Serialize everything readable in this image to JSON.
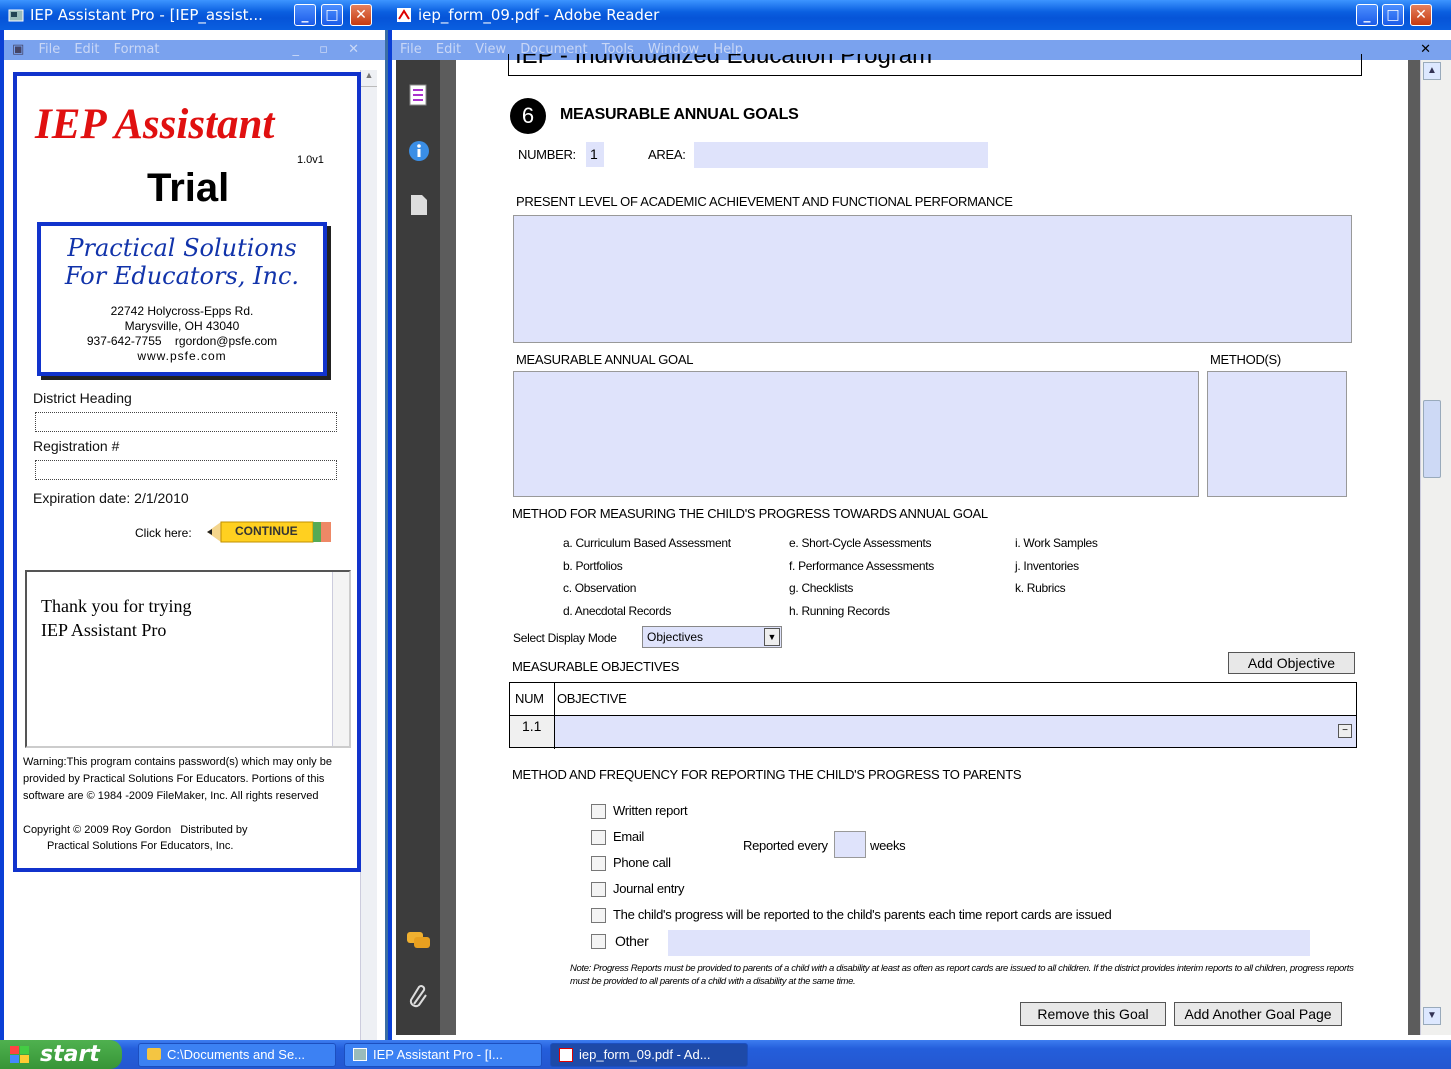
{
  "left_window": {
    "title": "IEP Assistant Pro - [IEP_assist...",
    "menu": [
      "File",
      "Edit",
      "Format"
    ],
    "brand": {
      "name": "IEP Assistant",
      "version": "1.0v1",
      "edition": "Trial"
    },
    "company": {
      "name_line1": "Practical Solutions",
      "name_line2": "For Educators, Inc.",
      "address1": "22742 Holycross-Epps Rd.",
      "address2": "Marysville, OH 43040",
      "phone_email": "937-642-7755    rgordon@psfe.com",
      "web": "www.psfe.com"
    },
    "district_heading_label": "District Heading",
    "registration_label": "Registration #",
    "expiration": "Expiration date: 2/1/2010",
    "click_here": "Click here:",
    "continue_label": "CONTINUE",
    "message_line1": "Thank you for trying",
    "message_line2": "IEP Assistant Pro",
    "warning": "Warning:This program contains password(s) which may only be provided by Practical Solutions For Educators.  Portions of this software are © 1984 -2009 FileMaker, Inc. All rights reserved",
    "copyright_line1": "Copyright © 2009 Roy Gordon   Distributed by",
    "copyright_line2": "Practical Solutions For Educators, Inc."
  },
  "right_window": {
    "title": "iep_form_09.pdf - Adobe Reader",
    "menu": [
      "File",
      "Edit",
      "View",
      "Document",
      "Tools",
      "Window",
      "Help"
    ],
    "header_partial": "IEP - Individualized Education Program",
    "section_number": "6",
    "section_title": "MEASURABLE ANNUAL GOALS",
    "number_label": "NUMBER:",
    "number_value": "1",
    "area_label": "AREA:",
    "present_level_label": "PRESENT LEVEL OF ACADEMIC ACHIEVEMENT AND FUNCTIONAL PERFORMANCE",
    "goal_label": "MEASURABLE ANNUAL GOAL",
    "methods_label": "METHOD(S)",
    "measuring_label": "METHOD FOR MEASURING THE CHILD'S PROGRESS TOWARDS ANNUAL GOAL",
    "methods_col1": [
      "a. Curriculum Based Assessment",
      "b. Portfolios",
      "c. Observation",
      "d. Anecdotal Records"
    ],
    "methods_col2": [
      "e. Short-Cycle Assessments",
      "f. Performance Assessments",
      "g. Checklists",
      "h. Running Records"
    ],
    "methods_col3": [
      "i. Work Samples",
      "j. Inventories",
      "k. Rubrics"
    ],
    "display_mode_label": "Select Display Mode",
    "display_mode_value": "Objectives",
    "objectives_label": "MEASURABLE OBJECTIVES",
    "add_objective": "Add Objective",
    "table_headers": [
      "NUM",
      "OBJECTIVE"
    ],
    "table_rows": [
      {
        "num": "1.1",
        "objective": ""
      }
    ],
    "reporting_label": "METHOD AND FREQUENCY FOR REPORTING THE CHILD'S PROGRESS TO PARENTS",
    "report_options": [
      "Written report",
      "Email",
      "Phone call",
      "Journal entry",
      "The child's progress will be reported to the child's parents each time report cards are issued",
      "Other"
    ],
    "reported_every": "Reported every",
    "weeks": "weeks",
    "note": "Note: Progress Reports must be provided to parents of a child with a disability at least as often as report cards are issued to all children. If the district provides interim reports to all children,  progress reports must be provided to all  parents of a child with a disability at the same time.",
    "remove_goal": "Remove this Goal",
    "add_goal_page": "Add Another Goal Page"
  },
  "taskbar": {
    "start": "start",
    "items": [
      "C:\\Documents and Se...",
      "IEP Assistant Pro - [I...",
      "iep_form_09.pdf - Ad..."
    ]
  },
  "colors": {
    "brand_red": "#e01010",
    "border_blue": "#1133cc",
    "field_fill": "#dfe3fb",
    "xp_blue": "#0a5fe0"
  }
}
